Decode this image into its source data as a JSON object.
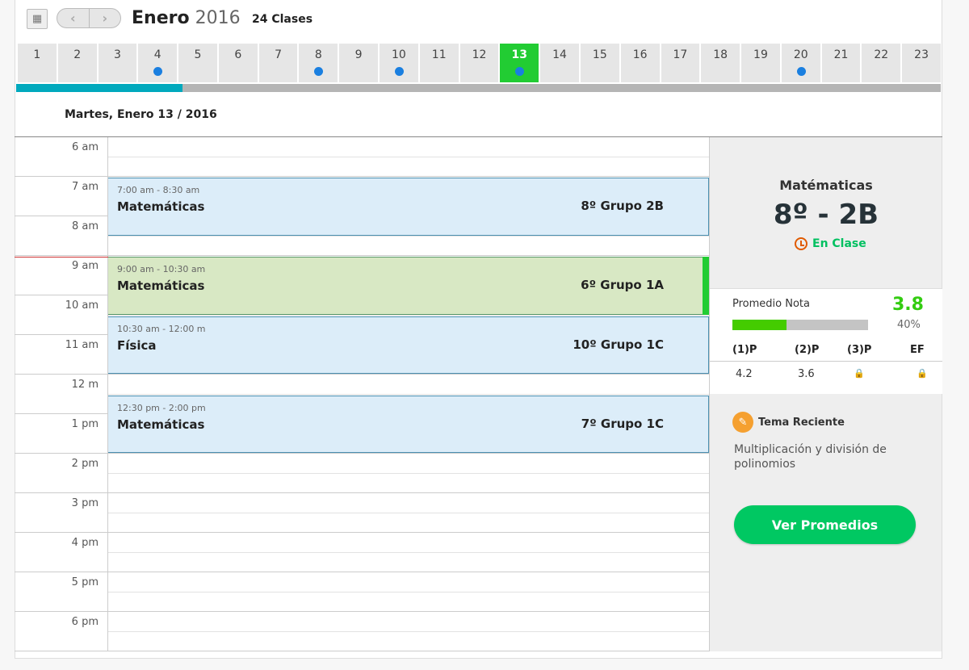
{
  "header": {
    "month": "Enero",
    "year": "2016",
    "classes": "24 Clases",
    "calendar_icon": "calendar-clock-icon",
    "prev": "‹",
    "next": "›"
  },
  "days": [
    {
      "n": "1",
      "dot": false
    },
    {
      "n": "2",
      "dot": false
    },
    {
      "n": "3",
      "dot": false
    },
    {
      "n": "4",
      "dot": true
    },
    {
      "n": "5",
      "dot": false
    },
    {
      "n": "6",
      "dot": false
    },
    {
      "n": "7",
      "dot": false
    },
    {
      "n": "8",
      "dot": true
    },
    {
      "n": "9",
      "dot": false
    },
    {
      "n": "10",
      "dot": true
    },
    {
      "n": "11",
      "dot": false
    },
    {
      "n": "12",
      "dot": false
    },
    {
      "n": "13",
      "dot": true,
      "selected": true
    },
    {
      "n": "14",
      "dot": false
    },
    {
      "n": "15",
      "dot": false
    },
    {
      "n": "16",
      "dot": false
    },
    {
      "n": "17",
      "dot": false
    },
    {
      "n": "18",
      "dot": false
    },
    {
      "n": "19",
      "dot": false
    },
    {
      "n": "20",
      "dot": true
    },
    {
      "n": "21",
      "dot": false
    },
    {
      "n": "22",
      "dot": false
    },
    {
      "n": "23",
      "dot": false
    }
  ],
  "month_progress_percent": 18,
  "date_header": "Martes, Enero 13 / 2016",
  "hours": [
    "6 am",
    "7 am",
    "8 am",
    "9 am",
    "10 am",
    "11 am",
    "12 m",
    "1 pm",
    "2 pm",
    "3 pm",
    "4 pm",
    "5 pm",
    "6 pm"
  ],
  "events": [
    {
      "time": "7:00 am - 8:30 am",
      "subject": "Matemáticas",
      "group": "8º  Grupo 2B",
      "start": 7,
      "end": 8.5,
      "active": false
    },
    {
      "time": "9:00 am - 10:30 am",
      "subject": "Matemáticas",
      "group": "6º  Grupo 1A",
      "start": 9,
      "end": 10.5,
      "active": true
    },
    {
      "time": "10:30 am - 12:00 m",
      "subject": "Física",
      "group": "10º Grupo 1C",
      "start": 10.5,
      "end": 12,
      "active": false
    },
    {
      "time": "12:30 pm - 2:00 pm",
      "subject": "Matemáticas",
      "group": "7º  Grupo 1C",
      "start": 12.5,
      "end": 14,
      "active": false
    }
  ],
  "colors": {
    "accent": "#22cc33",
    "progress": "#00a9bd",
    "event": "#dcedf9",
    "active_event": "#d8e8c4",
    "button": "#00c862"
  },
  "panel": {
    "subject": "Matématicas",
    "group": "8º - 2B",
    "status": "En Clase",
    "avg_label": "Promedio Nota",
    "avg_value": "3.8",
    "avg_percent_label": "40%",
    "avg_percent": 40,
    "columns": [
      "(1)P",
      "(2)P",
      "(3)P",
      "EF"
    ],
    "values": [
      "4.2",
      "3.6",
      "",
      ""
    ],
    "topic_title": "Tema Reciente",
    "topic": "Multiplicación y división de polinomios",
    "button": "Ver Promedios"
  }
}
